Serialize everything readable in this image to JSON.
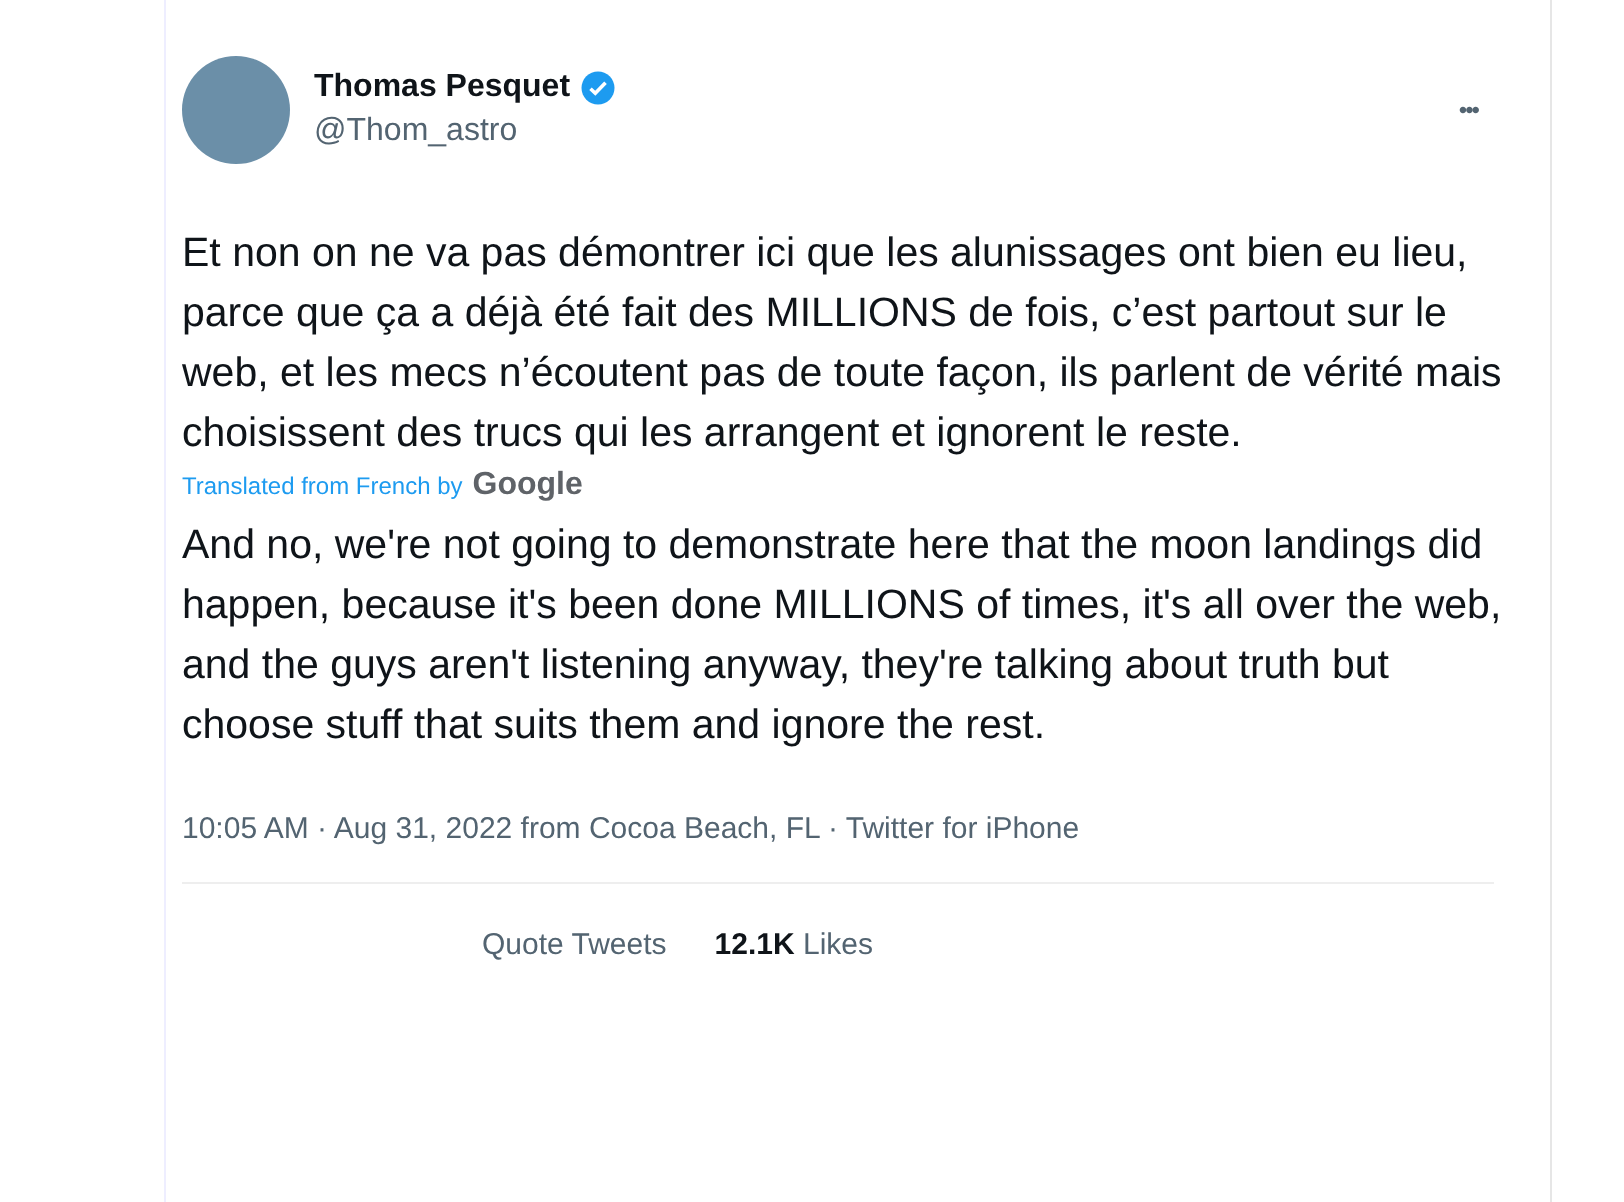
{
  "author": {
    "name": "Thomas Pesquet",
    "handle": "@Thom_astro",
    "verified": true
  },
  "menu": "•••",
  "text": "Et non on ne va pas démontrer ici que les alunissages ont bien eu lieu, parce que ça a déjà été fait des MILLIONS de fois, c’est partout sur le web, et les mecs n’écoutent pas de toute façon, ils parlent de vérité mais choisissent des trucs qui les arrangent et ignorent le reste.",
  "translation": {
    "label": "Translated from French by",
    "provider": "Google",
    "text": "And no, we're not going to demonstrate here that the moon landings did happen, because it's been done MILLIONS of times, it's all over the web, and the guys aren't listening anyway, they're talking about truth but choose stuff that suits them and ignore the rest."
  },
  "meta": "10:05 AM · Aug 31, 2022 from Cocoa Beach, FL · Twitter for iPhone",
  "stats": [
    {
      "label": "Quote Tweets"
    },
    {
      "count": "12.1K",
      "label": "Likes"
    }
  ]
}
